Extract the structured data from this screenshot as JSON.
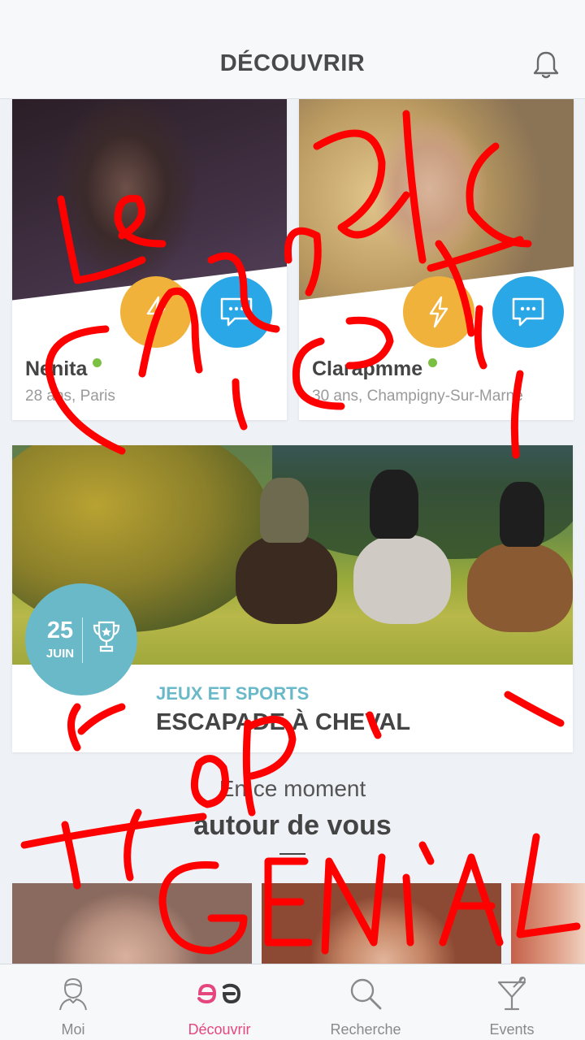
{
  "header": {
    "title": "DÉCOUVRIR",
    "bell_icon": "bell-icon"
  },
  "profiles": [
    {
      "name": "Nenita",
      "info": "28 ans, Paris",
      "online": true
    },
    {
      "name": "Clarapmme",
      "info": "30 ans, Champigny-Sur-Marne",
      "online": true
    }
  ],
  "event": {
    "day": "25",
    "month": "JUIN",
    "category": "JEUX ET SPORTS",
    "title": "ESCAPADE À CHEVAL"
  },
  "nearby": {
    "subtitle": "En ce moment",
    "title": "autour de vous"
  },
  "tabs": [
    {
      "label": "Moi",
      "icon": "user-icon"
    },
    {
      "label": "Découvrir",
      "icon": "discover-logo-icon",
      "active": true
    },
    {
      "label": "Recherche",
      "icon": "search-icon"
    },
    {
      "label": "Events",
      "icon": "cocktail-icon"
    }
  ],
  "colors": {
    "accent_pink": "#e5467f",
    "teal": "#6ab9c9",
    "flash_orange": "#f0b23a",
    "chat_blue": "#2aa7e6",
    "online_green": "#7bc043",
    "scribble_red": "#ff0000"
  }
}
